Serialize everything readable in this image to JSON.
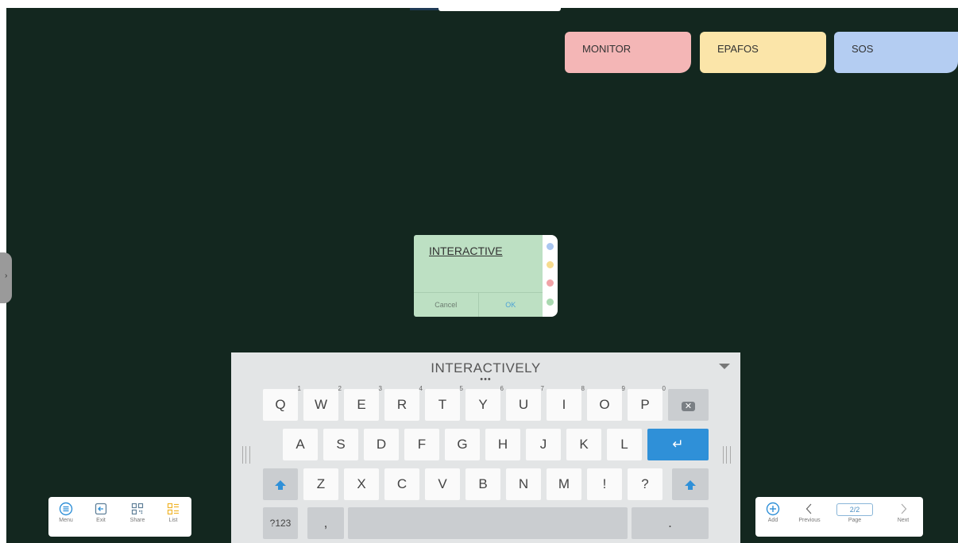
{
  "notes": [
    {
      "label": "MONITOR",
      "color": "#f4b6b6"
    },
    {
      "label": "EPAFOS",
      "color": "#fbe5a9"
    },
    {
      "label": "SOS",
      "color": "#b4cdf2"
    }
  ],
  "editor": {
    "text": "INTERACTIVE",
    "cancel_label": "Cancel",
    "ok_label": "OK",
    "color_options": [
      "#a9c6f0",
      "#f7dc8f",
      "#f1a3a7",
      "#a9d9b0"
    ]
  },
  "keyboard": {
    "suggestion": "INTERACTIVELY",
    "more": "•••",
    "row1": [
      {
        "k": "Q",
        "n": "1"
      },
      {
        "k": "W",
        "n": "2"
      },
      {
        "k": "E",
        "n": "3"
      },
      {
        "k": "R",
        "n": "4"
      },
      {
        "k": "T",
        "n": "5"
      },
      {
        "k": "Y",
        "n": "6"
      },
      {
        "k": "U",
        "n": "7"
      },
      {
        "k": "I",
        "n": "8"
      },
      {
        "k": "O",
        "n": "9"
      },
      {
        "k": "P",
        "n": "0"
      }
    ],
    "row2": [
      "A",
      "S",
      "D",
      "F",
      "G",
      "H",
      "J",
      "K",
      "L"
    ],
    "row3": [
      "Z",
      "X",
      "C",
      "V",
      "B",
      "N",
      "M",
      "!",
      "?"
    ],
    "symbols_label": "?123",
    "comma": ",",
    "period": ".",
    "enter_symbol": "↵",
    "backspace_symbol": "✕"
  },
  "left_toolbar": [
    {
      "label": "Menu",
      "icon": "menu-icon"
    },
    {
      "label": "Exit",
      "icon": "exit-icon"
    },
    {
      "label": "Share",
      "icon": "qr-share-icon"
    },
    {
      "label": "List",
      "icon": "list-icon"
    }
  ],
  "right_toolbar": {
    "add_label": "Add",
    "previous_label": "Previous",
    "page_value": "2/2",
    "page_label": "Page",
    "next_label": "Next"
  },
  "colors": {
    "board": "#13271f",
    "accent_blue": "#2f90d8"
  }
}
